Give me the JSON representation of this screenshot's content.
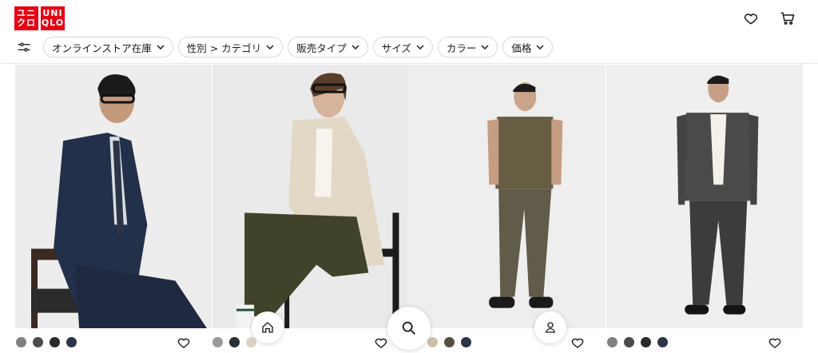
{
  "brand": {
    "logo_top": "ユニ クロ",
    "logo_right": "UNI QLO",
    "color": "#e60012"
  },
  "header": {
    "icons": [
      "heart-icon",
      "cart-icon"
    ]
  },
  "filters": [
    {
      "label": "オンラインストア在庫"
    },
    {
      "label": "性別 > カテゴリ"
    },
    {
      "label": "販売タイプ"
    },
    {
      "label": "サイズ"
    },
    {
      "label": "カラー"
    },
    {
      "label": "価格"
    }
  ],
  "products": [
    {
      "swatches": [
        "#808080",
        "#4a4a4a",
        "#2a2a2a",
        "#2c3448"
      ]
    },
    {
      "swatches": [
        "#9a9a9a",
        "#2a2e36",
        "#ddd3c4"
      ]
    },
    {
      "swatches": [
        "#cdbfa8",
        "#5a4e42",
        "#2c3448"
      ]
    },
    {
      "swatches": [
        "#808080",
        "#4a4a4a",
        "#2a2a2a",
        "#2c3448"
      ]
    }
  ],
  "bottom_nav": [
    "home-icon",
    "search-icon",
    "account-icon"
  ]
}
